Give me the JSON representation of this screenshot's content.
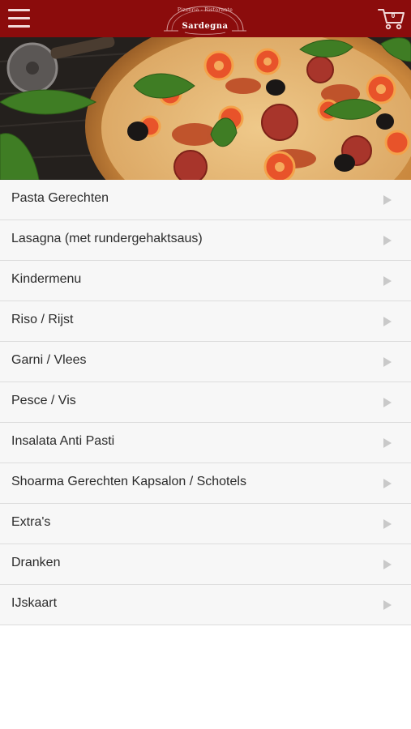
{
  "header": {
    "logo": {
      "name": "Sardegna",
      "subtitle": "Pizzeria - Ristorante"
    },
    "cart": {
      "count": "0"
    }
  },
  "menu": {
    "items": [
      {
        "label": "Pasta Gerechten"
      },
      {
        "label": "Lasagna (met rundergehaktsaus)"
      },
      {
        "label": "Kindermenu"
      },
      {
        "label": "Riso / Rijst"
      },
      {
        "label": "Garni / Vlees"
      },
      {
        "label": "Pesce / Vis"
      },
      {
        "label": "Insalata Anti Pasti"
      },
      {
        "label": "Shoarma Gerechten Kapsalon / Schotels"
      },
      {
        "label": "Extra's"
      },
      {
        "label": "Dranken"
      },
      {
        "label": "IJskaart"
      }
    ]
  },
  "colors": {
    "header_bg": "#8b0c0c",
    "list_bg": "#f7f7f7",
    "divider": "#dcdcdc",
    "arrow": "#c9c9c9"
  },
  "icons": {
    "menu": "hamburger-icon",
    "cart": "shopping-cart-icon",
    "row_arrow": "chevron-right-icon"
  }
}
